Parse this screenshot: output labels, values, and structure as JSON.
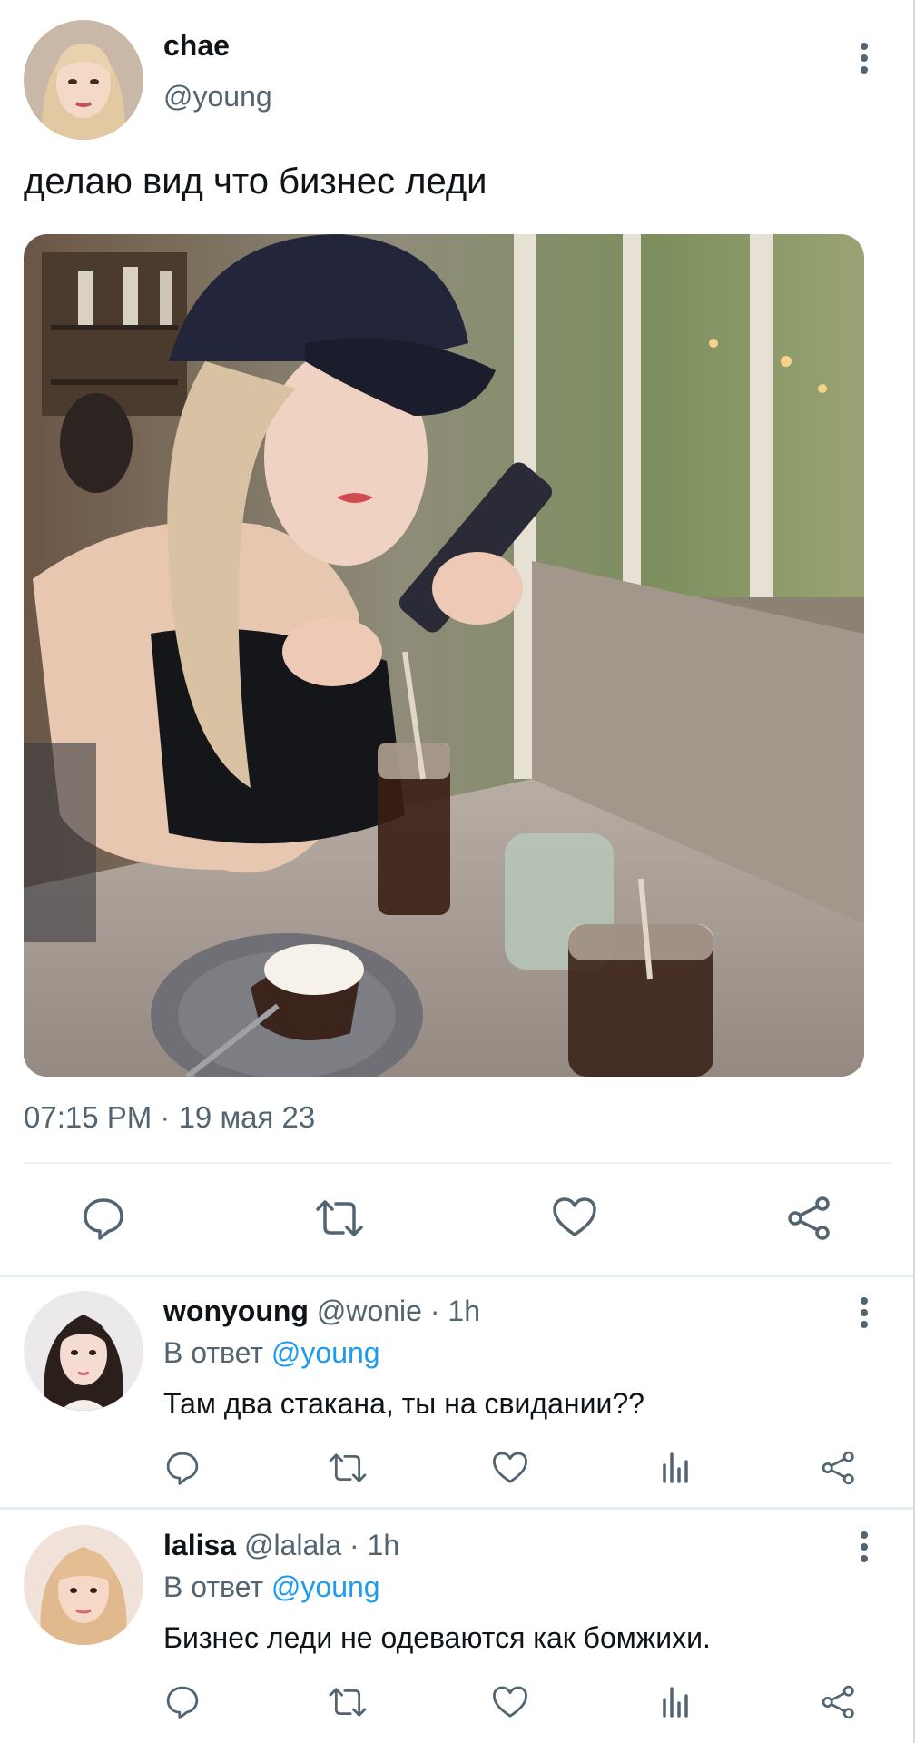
{
  "main_tweet": {
    "author_name": "chae",
    "author_handle": "@young",
    "text": "делаю вид что бизнес леди",
    "timestamp": "07:15 PM · 19 мая 23"
  },
  "replies": [
    {
      "author_name": "wonyoung",
      "meta": "@wonie · 1h",
      "reply_to_prefix": "В ответ",
      "reply_to_handle": "@young",
      "text": "Там два стакана, ты на свидании??"
    },
    {
      "author_name": "lalisa",
      "meta": "@lalala · 1h",
      "reply_to_prefix": "В ответ",
      "reply_to_handle": "@young",
      "text": "Бизнес леди не одеваются как бомжихи."
    }
  ],
  "icons": {
    "reply": "reply-icon",
    "retweet": "retweet-icon",
    "like": "heart-icon",
    "views": "views-icon",
    "share": "share-icon",
    "more": "more-vertical-icon"
  },
  "colors": {
    "text": "#0f1419",
    "secondary": "#536471",
    "link": "#1d9bf0"
  }
}
